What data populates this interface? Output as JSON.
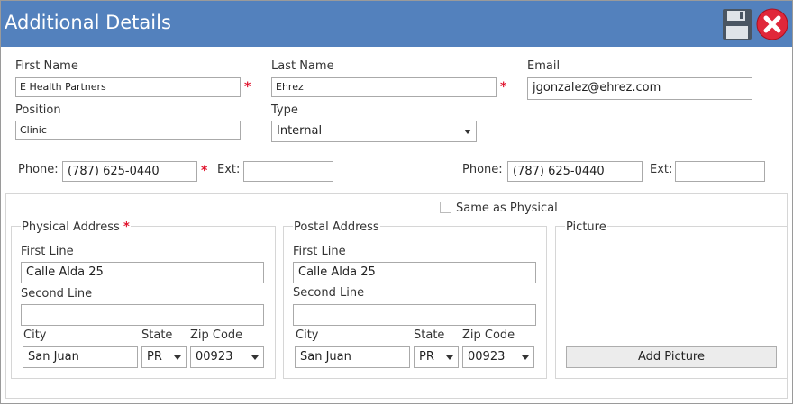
{
  "window": {
    "title": "Additional Details"
  },
  "toolbar": {
    "save_icon": "floppy-disk-icon",
    "close_icon": "close-x-icon",
    "accent": "#5381bd",
    "required_color": "#e0102a"
  },
  "fields": {
    "first_name_label": "First Name",
    "first_name": "E Health Partners",
    "last_name_label": "Last Name",
    "last_name": "Ehrez",
    "email_label": "Email",
    "email": "jgonzalez@ehrez.com",
    "position_label": "Position",
    "position": "Clinic",
    "type_label": "Type",
    "type": "Internal",
    "required_mark": "*"
  },
  "phones": {
    "left": {
      "label": "Phone:",
      "value": "(787) 625-0440",
      "ext_label": "Ext:",
      "ext": ""
    },
    "right": {
      "label": "Phone:",
      "value": "(787) 625-0440",
      "ext_label": "Ext:",
      "ext": ""
    }
  },
  "same_as_physical": {
    "label": "Same as Physical",
    "checked": false
  },
  "physical": {
    "title": "Physical Address",
    "first_line_label": "First Line",
    "first_line": "Calle Alda 25",
    "second_line_label": "Second Line",
    "second_line": "",
    "city_label": "City",
    "city": "San Juan",
    "state_label": "State",
    "state": "PR",
    "zip_label": "Zip Code",
    "zip": "00923"
  },
  "postal": {
    "title": "Postal Address",
    "first_line_label": "First Line",
    "first_line": "Calle Alda 25",
    "second_line_label": "Second Line",
    "second_line": "",
    "city_label": "City",
    "city": "San Juan",
    "state_label": "State",
    "state": "PR",
    "zip_label": "Zip Code",
    "zip": "00923"
  },
  "picture": {
    "title": "Picture",
    "button": "Add Picture"
  }
}
